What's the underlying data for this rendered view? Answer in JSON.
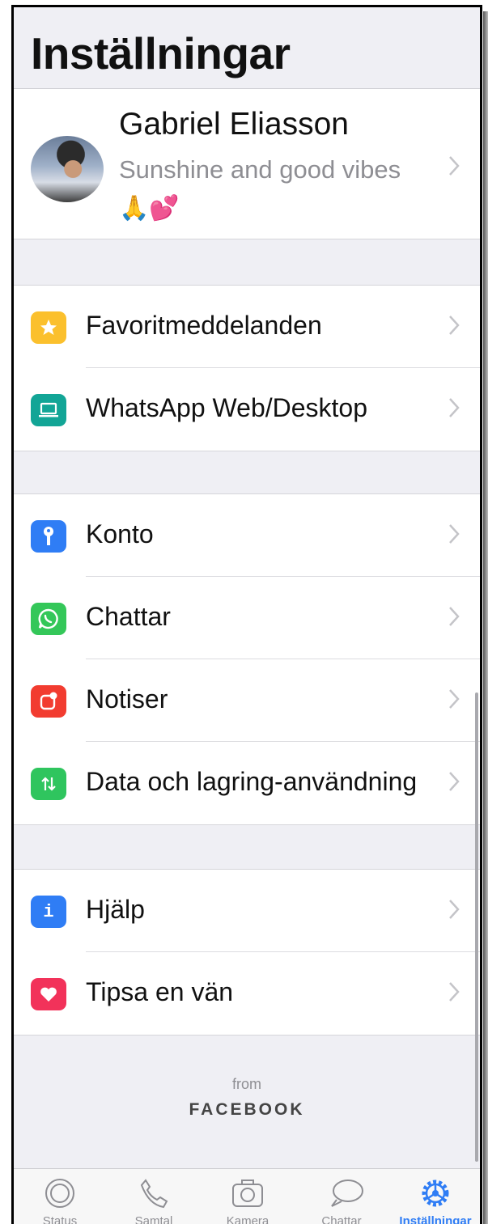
{
  "header": {
    "title": "Inställningar"
  },
  "profile": {
    "name": "Gabriel Eliasson",
    "status": "Sunshine and good vibes",
    "emoji": "🙏💕"
  },
  "groups": [
    {
      "items": [
        {
          "id": "favorites",
          "label": "Favoritmeddelanden",
          "icon": "star-icon",
          "color": "#fbc02d"
        },
        {
          "id": "web",
          "label": "WhatsApp Web/Desktop",
          "icon": "laptop-icon",
          "color": "#12a596"
        }
      ]
    },
    {
      "items": [
        {
          "id": "account",
          "label": "Konto",
          "icon": "key-icon",
          "color": "#2f7df5"
        },
        {
          "id": "chats",
          "label": "Chattar",
          "icon": "whatsapp-icon",
          "color": "#34c759"
        },
        {
          "id": "notifications",
          "label": "Notiser",
          "icon": "notification-icon",
          "color": "#f23c30"
        },
        {
          "id": "data",
          "label": "Data och lagring-användning",
          "icon": "data-transfer-icon",
          "color": "#2fc55e"
        }
      ]
    },
    {
      "items": [
        {
          "id": "help",
          "label": "Hjälp",
          "icon": "info-icon",
          "color": "#2f7df5"
        },
        {
          "id": "tell",
          "label": "Tipsa en vän",
          "icon": "heart-icon",
          "color": "#f2325a"
        }
      ]
    }
  ],
  "footer": {
    "from": "from",
    "brand": "FACEBOOK"
  },
  "tabbar": {
    "tabs": [
      {
        "id": "status",
        "label": "Status",
        "icon": "status-icon"
      },
      {
        "id": "calls",
        "label": "Samtal",
        "icon": "phone-icon"
      },
      {
        "id": "camera",
        "label": "Kamera",
        "icon": "camera-icon"
      },
      {
        "id": "chats",
        "label": "Chattar",
        "icon": "chat-bubbles-icon"
      },
      {
        "id": "settings",
        "label": "Inställningar",
        "icon": "gear-icon",
        "active": true
      }
    ]
  }
}
